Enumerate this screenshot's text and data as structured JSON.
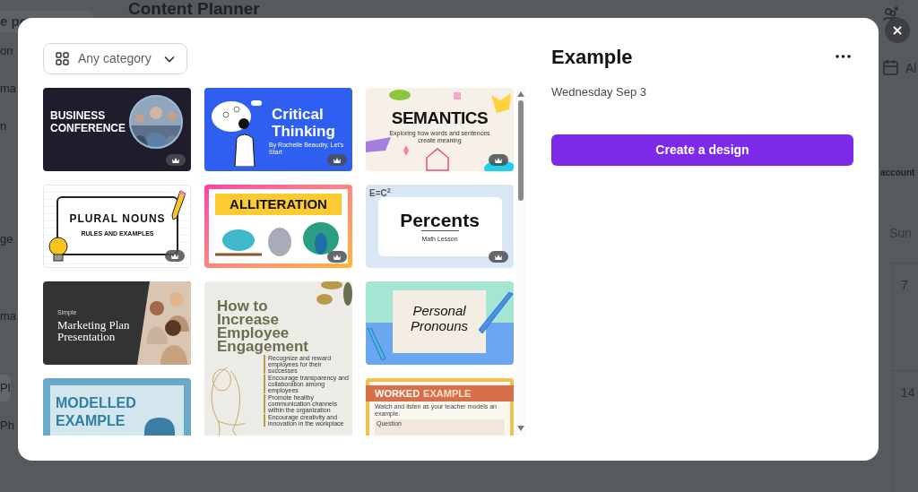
{
  "background_page": {
    "title": "Content Planner",
    "sidebar_heading": "e pe",
    "sidebar_items": [
      {
        "label": "on",
        "selected": false
      },
      {
        "label": "ma",
        "selected": false
      },
      {
        "label": "n",
        "selected": false
      },
      {
        "label": "ge",
        "selected": false
      },
      {
        "label": "ma",
        "selected": false
      },
      {
        "label": "Pl",
        "selected": true
      },
      {
        "label": "Ph",
        "selected": false
      }
    ],
    "view_label": "Al",
    "account_label": "account",
    "weekday": "Sun",
    "dates": [
      "7",
      "14"
    ]
  },
  "dialog": {
    "category_filter": "Any category",
    "template_columns": [
      {
        "templates": [
          {
            "kind": "business",
            "title": "BUSINESS CONFERENCE",
            "premium": true
          },
          {
            "kind": "plural",
            "title": "PLURAL NOUNS",
            "subtitle": "RULES AND EXAMPLES",
            "premium": true
          },
          {
            "kind": "marketing",
            "eyebrow": "Simple",
            "title": "Marketing Plan Presentation",
            "premium": false
          },
          {
            "kind": "modelled",
            "title": "MODELLED EXAMPLE",
            "premium": false
          }
        ]
      },
      {
        "templates": [
          {
            "kind": "critical",
            "title": "Critical Thinking",
            "subtitle": "By Rochelle Beaudry, Let's Start",
            "premium": true
          },
          {
            "kind": "alliteration",
            "title": "ALLITERATION",
            "premium": true
          },
          {
            "kind": "engagement",
            "title": "How to Increase Employee Engagement",
            "bullets": [
              "Recognize and reward employees for their successes",
              "Encourage transparency and collaboration among employees",
              "Promote healthy communication channels within the organization",
              "Encourage creativity and innovation in the workplace"
            ],
            "premium": false
          }
        ]
      },
      {
        "templates": [
          {
            "kind": "semantics",
            "title": "SEMANTICS",
            "subtitle": "Exploring how words and sentences create meaning",
            "premium": true
          },
          {
            "kind": "percents",
            "formula": "E=C$^{2}$",
            "title": "Percents",
            "subtitle": "Math Lesson",
            "premium": true
          },
          {
            "kind": "pronouns",
            "title": "Personal Pronouns",
            "premium": false
          },
          {
            "kind": "worked",
            "title": "WORKED",
            "title_2": "EXAMPLE",
            "subtitle": "Watch and listen as your teacher models an example.",
            "field_label": "Question",
            "premium": false
          }
        ]
      }
    ],
    "title": "Example",
    "date": "Wednesday Sep 3",
    "create_button": "Create a design"
  }
}
